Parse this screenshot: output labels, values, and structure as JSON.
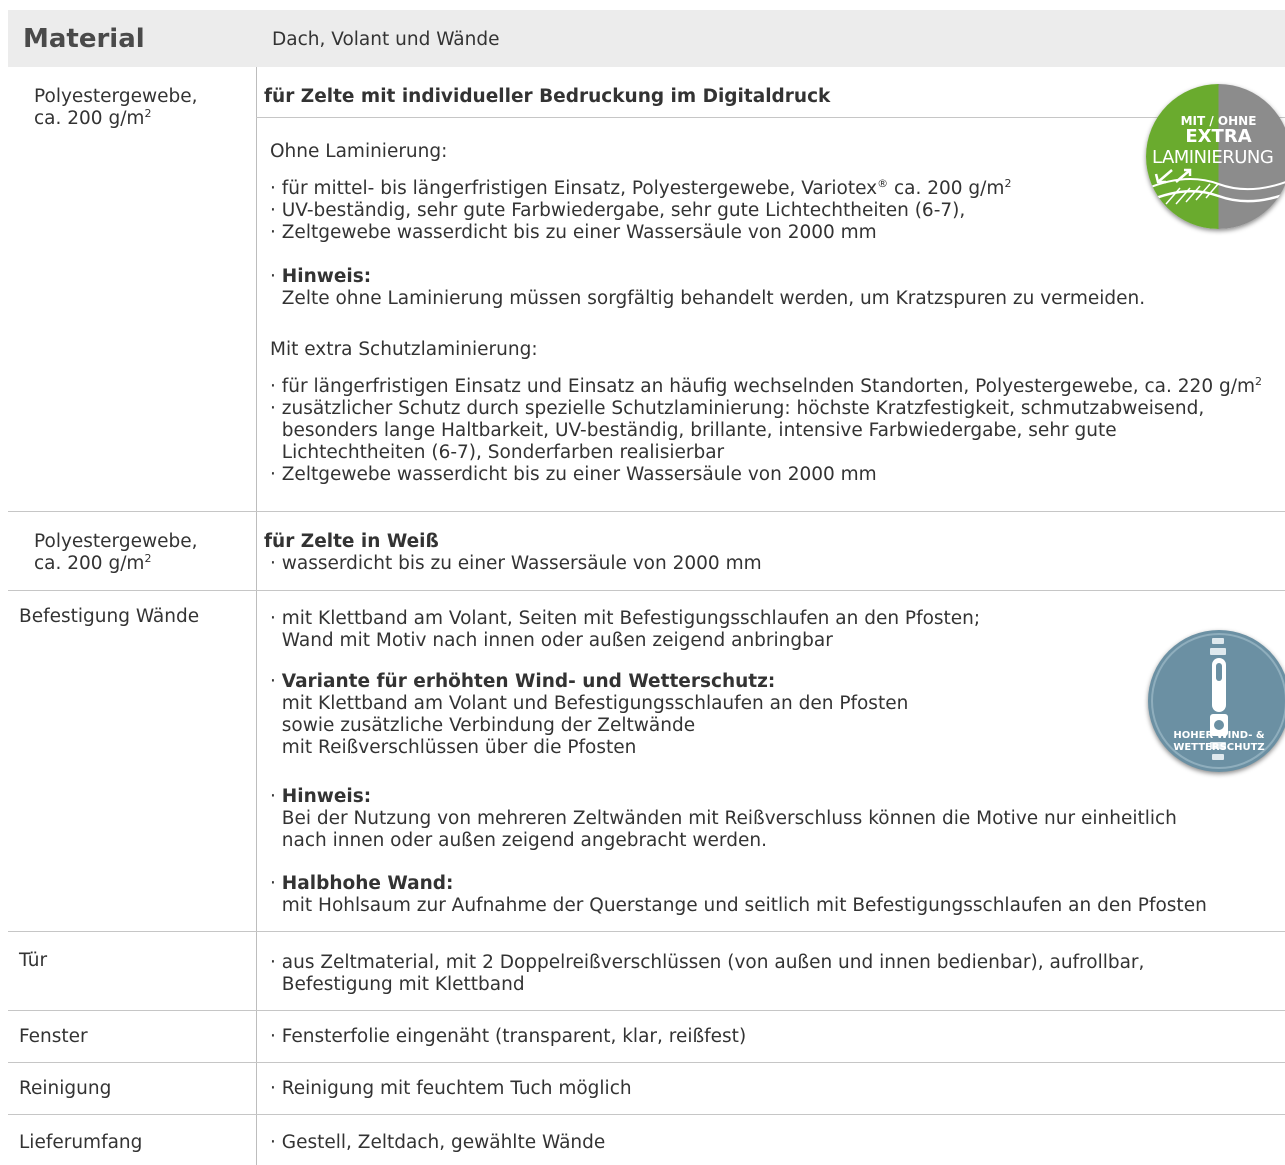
{
  "header": {
    "title": "Material",
    "subtitle": "Dach, Volant und Wände"
  },
  "rows": {
    "r1": {
      "label_1": "Polyestergewebe,",
      "label_2": "ca. 200 g/m",
      "label_sup": "2",
      "heading": "für Zelte mit individueller Bedruckung im Digitaldruck",
      "ohne_title": "Ohne Laminierung:",
      "ohne_b1a": "· für mittel- bis längerfristigen Einsatz, Polyestergewebe, Variotex",
      "ohne_b1_reg": "®",
      "ohne_b1b": " ca. 200 g/m",
      "ohne_b1_sup": "2",
      "ohne_b2": "· UV-beständig, sehr gute Farbwiedergabe, sehr gute Lichtechtheiten (6-7),",
      "ohne_b3": "· Zeltgewebe wasserdicht bis zu einer Wassersäule von 2000 mm",
      "hinweis_dot": "· ",
      "hinweis_label": "Hinweis:",
      "hinweis_text": "  Zelte ohne Laminierung müssen sorgfältig behandelt werden, um Kratzspuren zu vermeiden.",
      "mit_title": "Mit extra Schutzlaminierung:",
      "mit_b1": "· für längerfristigen Einsatz und Einsatz an häufig wechselnden Standorten, Polyestergewebe, ca. 220 g/m",
      "mit_b1_sup": "2",
      "mit_b2a": "· zusätzlicher Schutz durch spezielle Schutzlaminierung: höchste Kratzfestigkeit, schmutzabweisend,",
      "mit_b2b": "  besonders lange Haltbarkeit, UV-beständig, brillante, intensive Farbwiedergabe, sehr gute",
      "mit_b2c": "  Lichtechtheiten (6-7), Sonderfarben realisierbar",
      "mit_b3": "· Zeltgewebe wasserdicht bis zu einer Wassersäule von 2000 mm"
    },
    "r2": {
      "label_1": "Polyestergewebe,",
      "label_2": "ca. 200 g/m",
      "label_sup": "2",
      "heading": "für Zelte in Weiß",
      "b1": "· wasserdicht bis zu einer Wassersäule von 2000 mm"
    },
    "r3": {
      "label": "Befestigung Wände",
      "b1a": "· mit Klettband am Volant, Seiten mit Befestigungsschlaufen an den Pfosten;",
      "b1b": "  Wand mit Motiv nach innen oder außen zeigend anbringbar",
      "var_dot": "· ",
      "var_label": "Variante für erhöhten Wind- und Wetterschutz:",
      "var_l1": "  mit Klettband am Volant und Befestigungsschlaufen an den Pfosten",
      "var_l2": "  sowie zusätzliche Verbindung der Zeltwände",
      "var_l3": "  mit Reißverschlüssen über die Pfosten",
      "hin_dot": "· ",
      "hin_label": "Hinweis:",
      "hin_l1": "  Bei der Nutzung von mehreren Zeltwänden mit Reißverschluss können die Motive nur einheitlich",
      "hin_l2": "  nach innen oder außen zeigend angebracht werden.",
      "halb_dot": "· ",
      "halb_label": "Halbhohe Wand:",
      "halb_l1": "  mit Hohlsaum zur Aufnahme der Querstange und seitlich mit Befestigungsschlaufen an den Pfosten"
    },
    "r4": {
      "label": "Tür",
      "l1": "· aus Zeltmaterial, mit 2 Doppelreißverschlüssen (von außen und innen bedienbar), aufrollbar,",
      "l2": "  Befestigung mit Klettband"
    },
    "r5": {
      "label": "Fenster",
      "l1": "· Fensterfolie eingenäht (transparent, klar, reißfest)"
    },
    "r6": {
      "label": "Reinigung",
      "l1": "· Reinigung mit feuchtem Tuch möglich"
    },
    "r7": {
      "label": "Lieferumfang",
      "l1": "· Gestell, Zeltdach, gewählte Wände"
    }
  },
  "badges": {
    "lamination": {
      "line1": "MIT / OHNE",
      "line2": "EXTRA",
      "line3": "LAMINIERUNG",
      "color_left": "#6aab2e",
      "color_right": "#8c8c8c"
    },
    "wind": {
      "line1": "HOHER WIND- &",
      "line2": "WETTERSCHUTZ",
      "color": "#6b90a3"
    }
  }
}
